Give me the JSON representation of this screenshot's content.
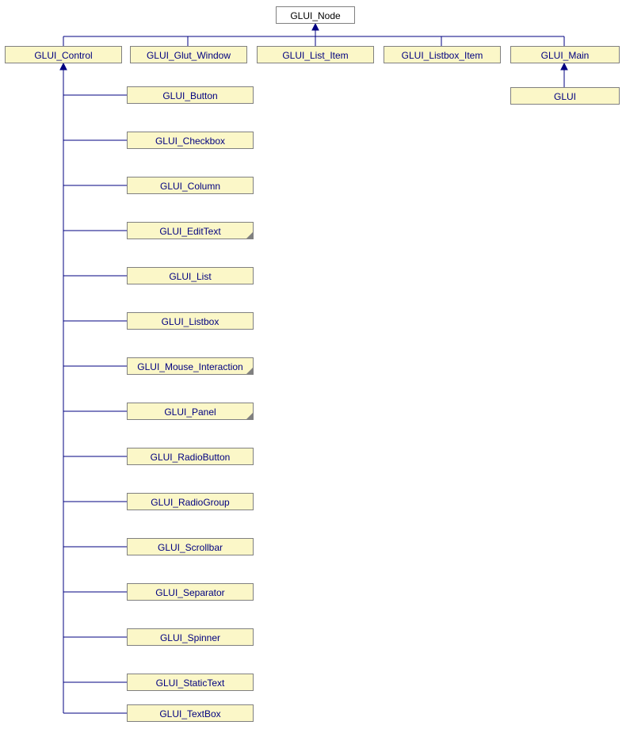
{
  "root": {
    "label": "GLUI_Node"
  },
  "row2": [
    {
      "label": "GLUI_Control"
    },
    {
      "label": "GLUI_Glut_Window"
    },
    {
      "label": "GLUI_List_Item"
    },
    {
      "label": "GLUI_Listbox_Item"
    },
    {
      "label": "GLUI_Main"
    }
  ],
  "glui": {
    "label": "GLUI"
  },
  "controls": [
    {
      "label": "GLUI_Button"
    },
    {
      "label": "GLUI_Checkbox"
    },
    {
      "label": "GLUI_Column"
    },
    {
      "label": "GLUI_EditText"
    },
    {
      "label": "GLUI_List"
    },
    {
      "label": "GLUI_Listbox"
    },
    {
      "label": "GLUI_Mouse_Interaction"
    },
    {
      "label": "GLUI_Panel"
    },
    {
      "label": "GLUI_RadioButton"
    },
    {
      "label": "GLUI_RadioGroup"
    },
    {
      "label": "GLUI_Scrollbar"
    },
    {
      "label": "GLUI_Separator"
    },
    {
      "label": "GLUI_Spinner"
    },
    {
      "label": "GLUI_StaticText"
    },
    {
      "label": "GLUI_TextBox"
    }
  ]
}
